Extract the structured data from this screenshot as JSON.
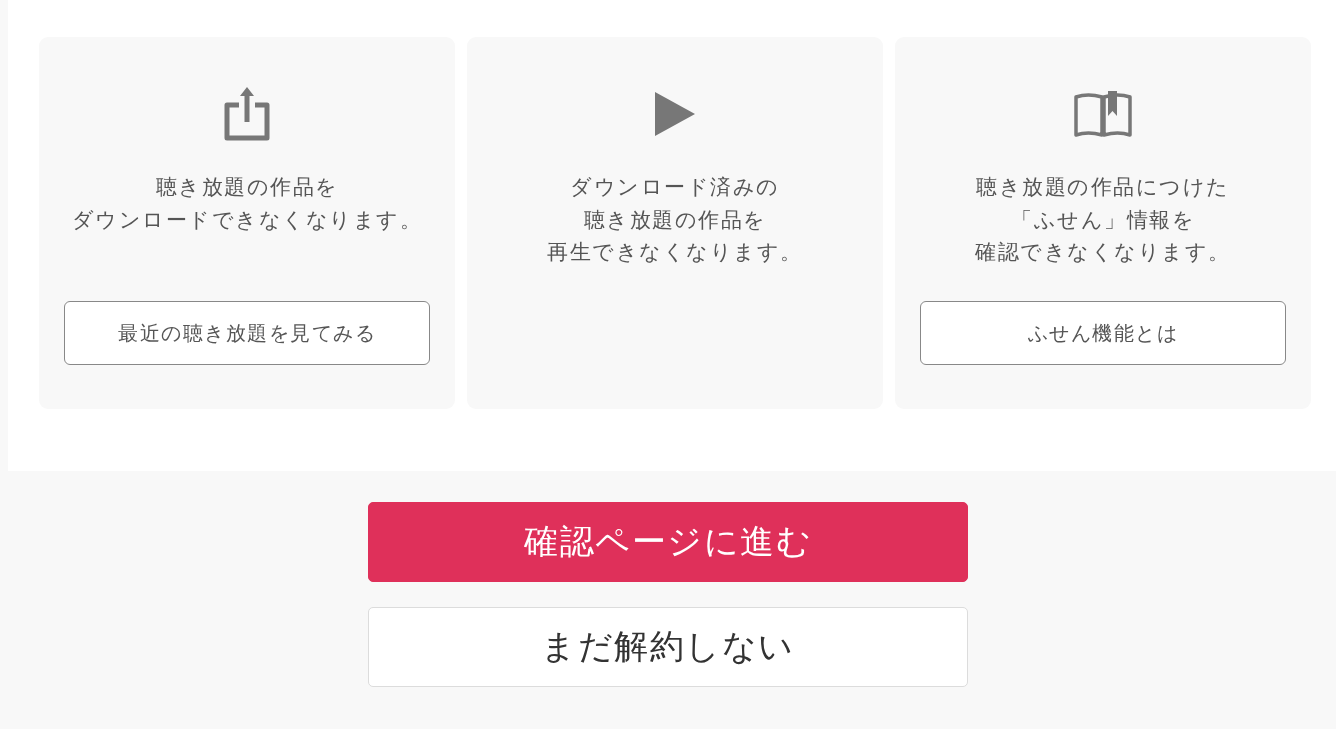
{
  "cards": [
    {
      "kind": "download",
      "lines": [
        "聴き放題の作品を",
        "ダウンロードできなくなります。"
      ],
      "button": "最近の聴き放題を見てみる"
    },
    {
      "kind": "playback",
      "lines": [
        "ダウンロード済みの",
        "聴き放題の作品を",
        "再生できなくなります。"
      ]
    },
    {
      "kind": "sticky-note",
      "lines": [
        "聴き放題の作品につけた",
        "「ふせん」情報を",
        "確認できなくなります。"
      ],
      "button": "ふせん機能とは"
    }
  ],
  "actions": [
    {
      "kind": "primary",
      "label": "確認ページに進む"
    },
    {
      "kind": "secondary",
      "label": "まだ解約しない"
    }
  ]
}
